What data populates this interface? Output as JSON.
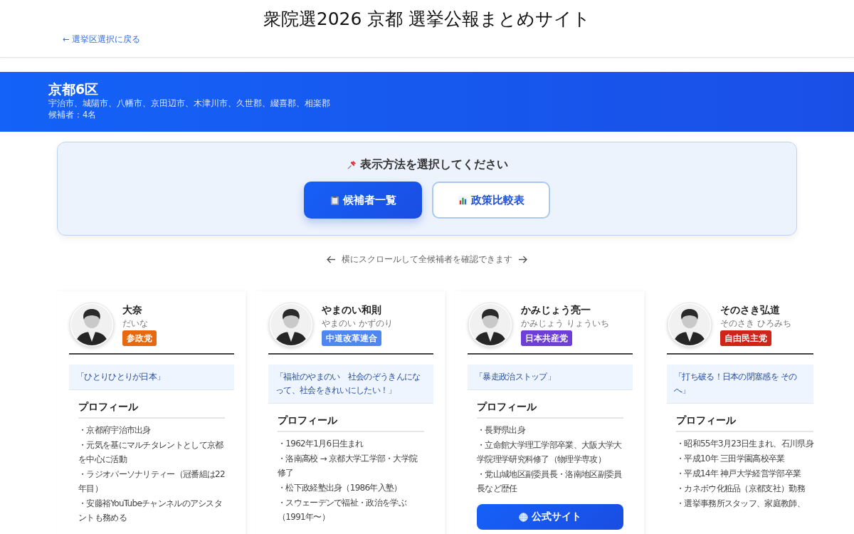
{
  "header": {
    "title": "衆院選2026 京都 選挙公報まとめサイト",
    "back_link": "← 選挙区選択に戻る"
  },
  "district": {
    "name": "京都6区",
    "areas": "宇治市、城陽市、八幡市、京田辺市、木津川市、久世郡、綴喜郡、相楽郡",
    "count": "候補者：4名"
  },
  "view_selector": {
    "heading": "表示方法を選択してください",
    "options": [
      {
        "kind": "list",
        "label": "候補者一覧",
        "selected": true
      },
      {
        "kind": "chart",
        "label": "政策比較表",
        "selected": false
      }
    ]
  },
  "scroll_hint": "横にスクロールして全候補者を確認できます",
  "candidates": [
    {
      "name": "大奈",
      "kana": "だいな",
      "party": "参政党",
      "color": "#e8680f",
      "clipped": false,
      "slogan": "「ひとりひとりが日本」",
      "profile_heading": "プロフィール",
      "profile": [
        "・京都府宇治市出身",
        "・元気を基にマルチタレントとして京都を中心に活動",
        "・ラジオパーソナリティー（冠番組は22年目）",
        "・安藤裕YouTubeチャンネルのアシスタントも務める"
      ]
    },
    {
      "name": "やまのい和則",
      "kana": "やまのい かずのり",
      "party": "中道改革連合",
      "color": "#4f86f0",
      "clipped": false,
      "slogan": "「福祉のやまのい　社会のぞうきんになって、社会をきれいにしたい！」",
      "profile_heading": "プロフィール",
      "profile": [
        "・1962年1月6日生まれ",
        "・洛南高校 → 京都大学工学部・大学院修了",
        "・松下政経塾出身（1986年入塾）",
        "・スウェーデンで福祉・政治を学ぶ（1991年〜）"
      ]
    },
    {
      "name": "かみじょう亮一",
      "kana": "かみじょう りょういち",
      "party": "日本共産党",
      "color": "#6d3ed8",
      "clipped": false,
      "slogan": "「暴走政治ストップ」",
      "profile_heading": "プロフィール",
      "profile": [
        "・長野県出身",
        "・立命館大学理工学部卒業、大阪大学大学院理学研究科修了（物理学専攻）",
        "・党山城地区副委員長・洛南地区副委員長など歴任"
      ],
      "website_button": "公式サイト"
    },
    {
      "name": "そのさき弘道",
      "kana": "そのさき ひろみち",
      "party": "自由民主党",
      "color": "#d0231a",
      "clipped": true,
      "slogan": "「打ち破る！日本の閉塞感を そのへ」",
      "profile_heading": "プロフィール",
      "profile": [
        "・昭和55年3月23日生まれ、石川県身",
        "・平成10年 三田学園高校卒業",
        "・平成14年 神戸大学経営学部卒業",
        "・カネボウ化粧品（京都支社）勤務",
        "・選挙事務所スタッフ、家庭教師、"
      ]
    }
  ]
}
